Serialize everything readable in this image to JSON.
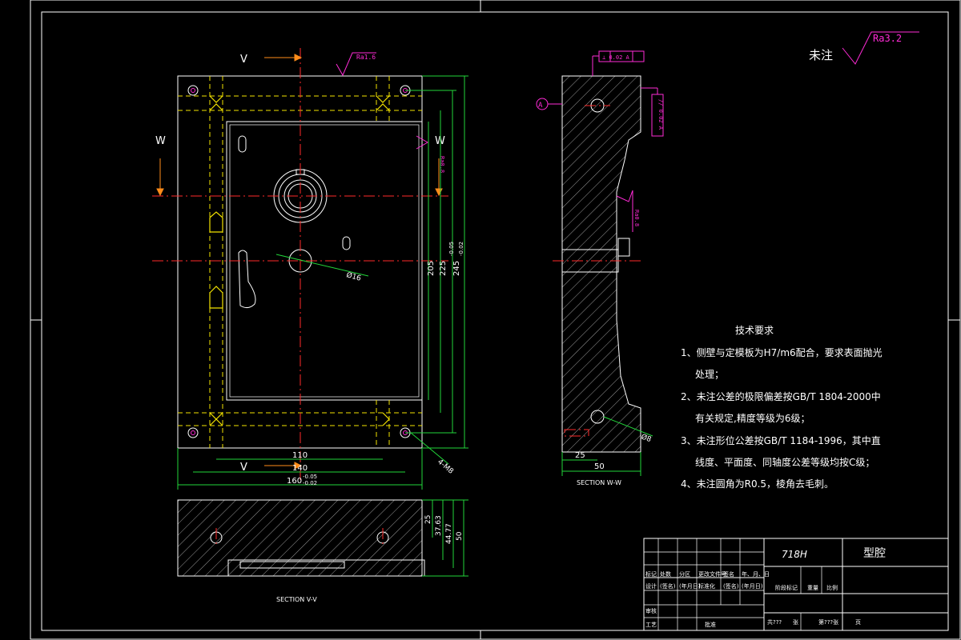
{
  "labels": {
    "section_v_left": "V",
    "section_v_bottom": "V",
    "section_w_left": "W",
    "section_w_right": "W",
    "ra_top": "Ra1.6",
    "ra_right_top": "Ra0.8",
    "ra_right_mid": "Ra0.8",
    "ra_general": "Ra3.2",
    "unmarked": "未注",
    "datum_a": "A",
    "gdt_top": "⊥ 0.02 A",
    "gdt_side": "// 0.02 A",
    "section_vv_title": "SECTION V-V",
    "section_ww_title": "SECTION W-W"
  },
  "dims": {
    "width_110": "110",
    "width_140": "140",
    "width_160": "160",
    "tol_160_top": "-0.05",
    "tol_160_bot": "-0.02",
    "h_205": "205",
    "h_225": "225",
    "h_245": "245",
    "tol_245_top": "-0.05",
    "tol_245_bot": "-0.02",
    "dia_16": "Ø16",
    "dia_8": "Ø8",
    "thread_m8": "4-M8",
    "d_25": "25",
    "d_37_63": "37.63",
    "d_44_77": "44.77",
    "d_50": "50",
    "ww_25": "25",
    "ww_50": "50"
  },
  "tech": {
    "title": "技术要求",
    "line1": "1、侧壁与定模板为H7/m6配合，要求表面抛光",
    "line1b": "处理；",
    "line2": "2、未注公差的极限偏差按GB/T 1804-2000中",
    "line2b": "有关规定,精度等级为6级；",
    "line3": "3、未注形位公差按GB/T 1184-1996，其中直",
    "line3b": "线度、平面度、同轴度公差等级均按C级；",
    "line4": "4、未注圆角为R0.5，棱角去毛刺。"
  },
  "title_block": {
    "material": "718H",
    "part_name": "型腔",
    "c_mark": "标记",
    "c_count": "处数",
    "c_zone": "分区",
    "c_doc": "更改文件号",
    "c_sign": "签名",
    "c_date": "年、月、日",
    "c_design": "设计",
    "c_sign2": "(签名)",
    "c_date2": "(年月日)",
    "c_std": "标准化",
    "c_sign3": "(签名)",
    "c_date3": "(年月日)",
    "c_stage": "阶段标记",
    "c_weight": "重量",
    "c_scale": "比例",
    "c_check": "审核",
    "c_process": "工艺",
    "c_approve": "批准",
    "c_total": "共???",
    "c_sheet": "张",
    "c_pages": "第???张",
    "c_ye": "页"
  }
}
